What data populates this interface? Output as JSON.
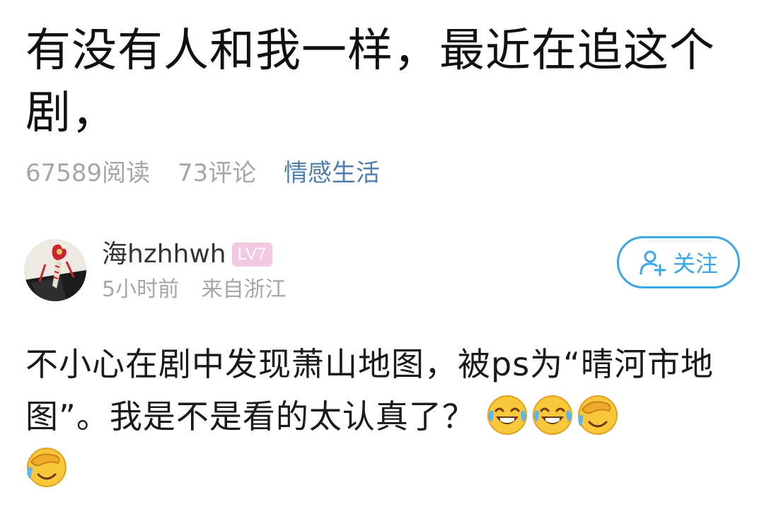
{
  "post": {
    "title": "有没有人和我一样，最近在追这个剧，",
    "read_count": "67589阅读",
    "comment_count": "73评论",
    "category": "情感生活"
  },
  "author": {
    "name": "海hzhhwh",
    "level": "LV7",
    "time": "5小时前",
    "location": "来自浙江",
    "follow_label": "关注"
  },
  "body": {
    "text": "不小心在剧中发现萧山地图，被ps为“晴河市地图”。我是不是看的太认真了？",
    "emojis": [
      "laugh-cry-emoji",
      "laugh-cry-emoji",
      "facepalm-cry-emoji",
      "facepalm-cry-emoji"
    ]
  },
  "colors": {
    "category": "#4f7fae",
    "follow": "#3aa7e8",
    "level_badge": "#f2c9e0",
    "meta": "#a6a6a6"
  }
}
